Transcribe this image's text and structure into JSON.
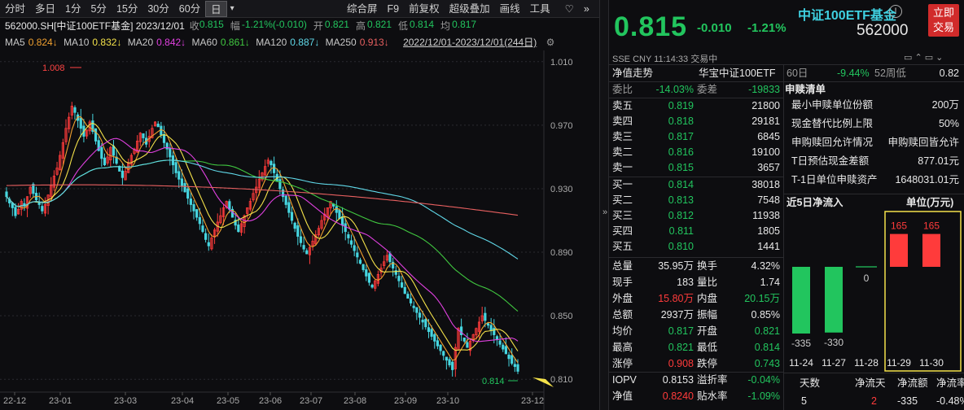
{
  "toolbar": {
    "periods": [
      "分时",
      "多日",
      "1分",
      "5分",
      "15分",
      "30分",
      "60分",
      "日"
    ],
    "active_period": "日",
    "dropdown_glyph": "▾",
    "right_items": [
      "综合屏",
      "F9",
      "前复权",
      "超级叠加",
      "画线",
      "工具"
    ],
    "heart_glyph": "♡",
    "more_glyph": "»"
  },
  "info": {
    "code_date": "562000.SH[中证100ETF基金] 2023/12/01",
    "close_label": "收",
    "close_value": "0.815",
    "range_label": "幅",
    "range_value": "-1.21%(-0.010)",
    "open_label": "开",
    "open_value": "0.821",
    "high_label": "高",
    "high_value": "0.821",
    "low_label": "低",
    "low_value": "0.814",
    "avg_label": "均",
    "avg_value": "0.817"
  },
  "ma_line": {
    "items": [
      {
        "label": "MA5",
        "value": "0.824↓",
        "color": "#f0a030"
      },
      {
        "label": "MA10",
        "value": "0.832↓",
        "color": "#f4e24a"
      },
      {
        "label": "MA20",
        "value": "0.842↓",
        "color": "#e040e0"
      },
      {
        "label": "MA60",
        "value": "0.861↓",
        "color": "#40c840"
      },
      {
        "label": "MA120",
        "value": "0.887↓",
        "color": "#60d8e8"
      },
      {
        "label": "MA250",
        "value": "0.913↓",
        "color": "#e86060"
      }
    ],
    "range_text": "2022/12/01-2023/12/01(244日)",
    "gear_icon": "⚙"
  },
  "chart_data": {
    "type": "candlestick",
    "y_ticks": [
      "1.010",
      "0.970",
      "0.930",
      "0.890",
      "0.850",
      "0.810"
    ],
    "ylim": [
      0.806,
      1.014
    ],
    "x_ticks": [
      "22-12",
      "23-01",
      "23-03",
      "23-04",
      "23-05",
      "23-06",
      "23-07",
      "23-08",
      "23-09",
      "23-10",
      "23-12"
    ],
    "annotations": {
      "high_label": "1.008",
      "low_label": "0.814"
    },
    "series_closes": [
      0.925,
      0.921,
      0.918,
      0.913,
      0.917,
      0.922,
      0.919,
      0.925,
      0.931,
      0.927,
      0.923,
      0.92,
      0.916,
      0.92,
      0.926,
      0.932,
      0.938,
      0.943,
      0.951,
      0.959,
      0.968,
      0.975,
      0.982,
      0.978,
      0.973,
      0.968,
      0.963,
      0.967,
      0.972,
      0.966,
      0.96,
      0.954,
      0.949,
      0.945,
      0.95,
      0.956,
      0.951,
      0.946,
      0.941,
      0.937,
      0.941,
      0.946,
      0.951,
      0.955,
      0.96,
      0.965,
      0.962,
      0.958,
      0.963,
      0.968,
      0.972,
      0.969,
      0.964,
      0.959,
      0.955,
      0.95,
      0.945,
      0.94,
      0.936,
      0.932,
      0.928,
      0.924,
      0.92,
      0.916,
      0.912,
      0.908,
      0.903,
      0.898,
      0.894,
      0.899,
      0.904,
      0.909,
      0.913,
      0.918,
      0.922,
      0.917,
      0.912,
      0.907,
      0.903,
      0.908,
      0.913,
      0.918,
      0.922,
      0.927,
      0.931,
      0.936,
      0.94,
      0.944,
      0.948,
      0.945,
      0.94,
      0.935,
      0.93,
      0.925,
      0.92,
      0.915,
      0.91,
      0.905,
      0.9,
      0.896,
      0.892,
      0.889,
      0.893,
      0.897,
      0.901,
      0.905,
      0.91,
      0.914,
      0.918,
      0.922,
      0.919,
      0.915,
      0.911,
      0.907,
      0.903,
      0.899,
      0.895,
      0.891,
      0.887,
      0.883,
      0.879,
      0.875,
      0.871,
      0.868,
      0.872,
      0.876,
      0.88,
      0.884,
      0.888,
      0.884,
      0.88,
      0.876,
      0.872,
      0.868,
      0.864,
      0.861,
      0.858,
      0.855,
      0.852,
      0.849,
      0.846,
      0.843,
      0.84,
      0.837,
      0.834,
      0.831,
      0.828,
      0.825,
      0.822,
      0.819,
      0.816,
      0.83,
      0.842,
      0.838,
      0.834,
      0.83,
      0.834,
      0.838,
      0.842,
      0.846,
      0.85,
      0.847,
      0.844,
      0.841,
      0.838,
      0.835,
      0.832,
      0.829,
      0.826,
      0.823,
      0.82,
      0.818,
      0.815
    ]
  },
  "right": {
    "name": "中证100ETF基金",
    "code": "562000",
    "alert_glyph": "!",
    "trade_btn": "立即交易",
    "price": "0.815",
    "change": "-0.010",
    "change_pct": "-1.21%",
    "meta": "SSE  CNY  11:14:33  交易中",
    "sixty_day_label": "60日",
    "sixty_day_value": "-9.44%",
    "week52_label": "52周低",
    "week52_value": "0.82",
    "nav_label": "净值走势",
    "nav_name": "华宝中证100ETF",
    "weibi_label": "委比",
    "weibi_value": "-14.03%",
    "weicha_label": "委差",
    "weicha_value": "-19833",
    "asks": [
      {
        "label": "卖五",
        "price": "0.819",
        "vol": "21800"
      },
      {
        "label": "卖四",
        "price": "0.818",
        "vol": "29181"
      },
      {
        "label": "卖三",
        "price": "0.817",
        "vol": "6845"
      },
      {
        "label": "卖二",
        "price": "0.816",
        "vol": "19100"
      },
      {
        "label": "卖一",
        "price": "0.815",
        "vol": "3657"
      }
    ],
    "bids": [
      {
        "label": "买一",
        "price": "0.814",
        "vol": "38018"
      },
      {
        "label": "买二",
        "price": "0.813",
        "vol": "7548"
      },
      {
        "label": "买三",
        "price": "0.812",
        "vol": "11938"
      },
      {
        "label": "买四",
        "price": "0.811",
        "vol": "1805"
      },
      {
        "label": "买五",
        "price": "0.810",
        "vol": "1441"
      }
    ],
    "stats": [
      {
        "l1": "总量",
        "v1": "35.95万",
        "c1": "white",
        "l2": "换手",
        "v2": "4.32%",
        "c2": "white"
      },
      {
        "l1": "现手",
        "v1": "183",
        "c1": "white",
        "l2": "量比",
        "v2": "1.74",
        "c2": "white"
      },
      {
        "l1": "外盘",
        "v1": "15.80万",
        "c1": "red",
        "l2": "内盘",
        "v2": "20.15万",
        "c2": "green"
      },
      {
        "l1": "总额",
        "v1": "2937万",
        "c1": "white",
        "l2": "振幅",
        "v2": "0.85%",
        "c2": "white"
      },
      {
        "l1": "均价",
        "v1": "0.817",
        "c1": "green",
        "l2": "开盘",
        "v2": "0.821",
        "c2": "green"
      },
      {
        "l1": "最高",
        "v1": "0.821",
        "c1": "green",
        "l2": "最低",
        "v2": "0.814",
        "c2": "green"
      },
      {
        "l1": "涨停",
        "v1": "0.908",
        "c1": "red",
        "l2": "跌停",
        "v2": "0.743",
        "c2": "green"
      },
      {
        "l1": "IOPV",
        "v1": "0.8153",
        "c1": "white",
        "l2": "溢折率",
        "v2": "-0.04%",
        "c2": "green"
      },
      {
        "l1": "净值",
        "v1": "0.8240",
        "c1": "red",
        "l2": "贴水率",
        "v2": "-1.09%",
        "c2": "green"
      }
    ],
    "redeem_title": "申赎清单",
    "redeem_rows": [
      {
        "label": "最小申赎单位份额",
        "value": "200万"
      },
      {
        "label": "现金替代比例上限",
        "value": "50%"
      },
      {
        "label": "申购赎回允许情况",
        "value": "申购赎回皆允许"
      },
      {
        "label": "T日预估现金差额",
        "value": "877.01元"
      },
      {
        "label": "T-1日单位申赎资产",
        "value": "1648031.01元"
      }
    ],
    "flow_title": "近5日净流入",
    "flow_unit": "单位(万元)",
    "flow_bars": [
      {
        "date": "11-24",
        "value": -335
      },
      {
        "date": "11-27",
        "value": -330
      },
      {
        "date": "11-28",
        "value": 0
      },
      {
        "date": "11-29",
        "value": 165
      },
      {
        "date": "11-30",
        "value": 165
      }
    ],
    "flow_labels": [
      "-335",
      "-330",
      "0",
      "165",
      "165"
    ],
    "bottom_headers": [
      "天数",
      "净流天",
      "净流额",
      "净流率"
    ],
    "bottom_values": [
      "5",
      "2",
      "-335",
      "-0.48%"
    ]
  }
}
